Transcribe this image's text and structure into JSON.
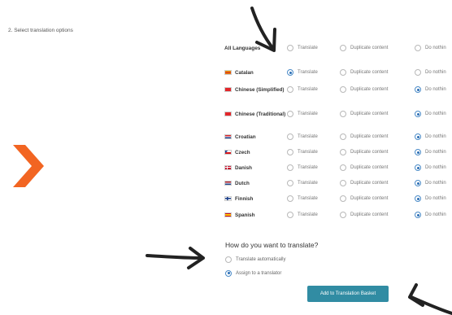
{
  "step": {
    "title": "2. Select translation options"
  },
  "options": {
    "translate": "Translate",
    "duplicate": "Duplicate content",
    "do_nothing": "Do nothin"
  },
  "all_languages": {
    "label": "All Languages",
    "selected": "none"
  },
  "languages": [
    {
      "name": "Catalan",
      "flag": "catalan",
      "selected": "translate"
    },
    {
      "name": "Chinese (Simplified)",
      "flag": "china",
      "selected": "do_nothing"
    },
    {
      "name": "Chinese (Traditional)",
      "flag": "china",
      "selected": "do_nothing"
    },
    {
      "name": "Croatian",
      "flag": "croatia",
      "selected": "do_nothing"
    },
    {
      "name": "Czech",
      "flag": "czech",
      "selected": "do_nothing"
    },
    {
      "name": "Danish",
      "flag": "denmark",
      "selected": "do_nothing"
    },
    {
      "name": "Dutch",
      "flag": "netherlands",
      "selected": "do_nothing"
    },
    {
      "name": "Finnish",
      "flag": "finland",
      "selected": "do_nothing"
    },
    {
      "name": "Spanish",
      "flag": "spain",
      "selected": "do_nothing"
    }
  ],
  "translate_method": {
    "question": "How do you want to translate?",
    "options": [
      {
        "label": "Translate automatically",
        "selected": false
      },
      {
        "label": "Assign to a translator",
        "selected": true
      }
    ]
  },
  "basket_button": {
    "label": "Add to Translation Basket",
    "color": "#318ca3"
  },
  "annotations": {
    "chevron_color": "#f26522",
    "arrow_color": "#222222"
  }
}
